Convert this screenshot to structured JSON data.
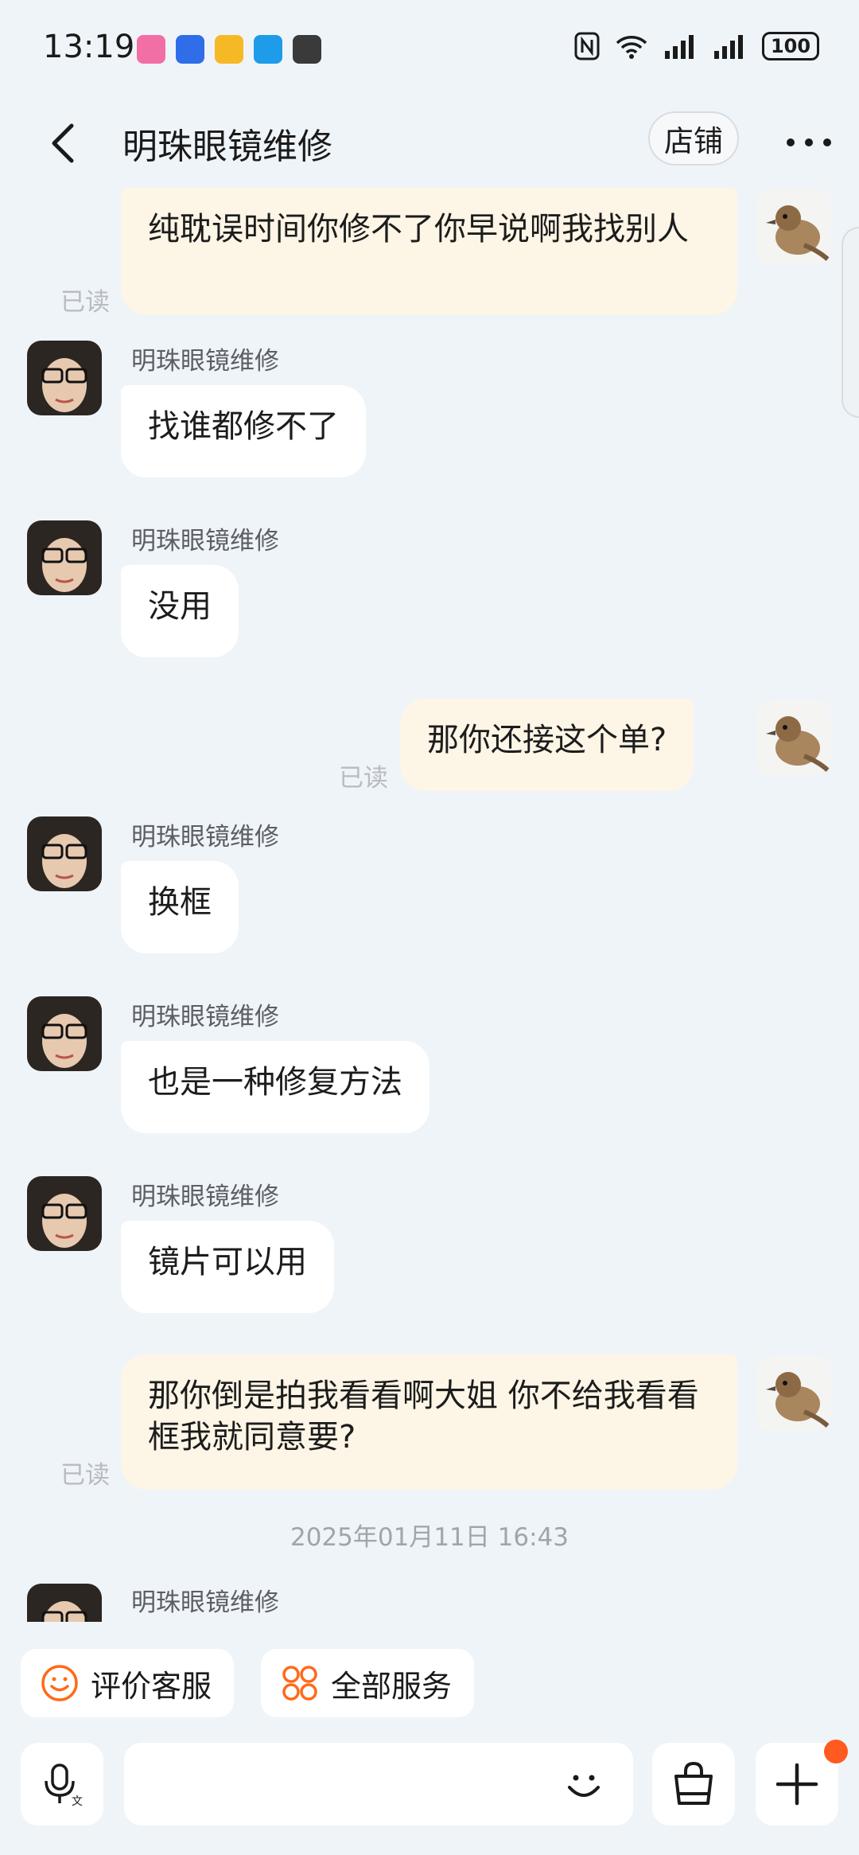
{
  "status_bar": {
    "time": "13:19",
    "battery": "100",
    "app_icons": [
      "bilibili-icon",
      "voice-recorder-icon",
      "mail-icon",
      "message-icon",
      "calligraphy-app-icon"
    ],
    "right_icons": [
      "nfc-icon",
      "wifi-icon",
      "signal-icon",
      "signal-icon"
    ]
  },
  "nav": {
    "title": "明珠眼镜维修",
    "store_label": "店铺"
  },
  "messages": [
    {
      "side": "out",
      "text": "纯耽误时间你修不了你早说啊我找别人",
      "read": "已读"
    },
    {
      "side": "in",
      "sender": "明珠眼镜维修",
      "text": "找谁都修不了"
    },
    {
      "side": "in",
      "sender": "明珠眼镜维修",
      "text": "没用"
    },
    {
      "side": "out",
      "text": "那你还接这个单?",
      "read": "已读"
    },
    {
      "side": "in",
      "sender": "明珠眼镜维修",
      "text": "换框"
    },
    {
      "side": "in",
      "sender": "明珠眼镜维修",
      "text": "也是一种修复方法"
    },
    {
      "side": "in",
      "sender": "明珠眼镜维修",
      "text": "镜片可以用"
    },
    {
      "side": "out",
      "text": "那你倒是拍我看看啊大姐 你不给我看看框我就同意要?",
      "read": "已读"
    },
    {
      "side": "in",
      "sender": "明珠眼镜维修",
      "text": ""
    }
  ],
  "timestamp": "2025年01月11日 16:43",
  "quick_actions": [
    {
      "label": "评价客服",
      "icon": "smile-icon"
    },
    {
      "label": "全部服务",
      "icon": "grid-icon"
    }
  ],
  "input": {
    "voice_icon": "voice-input-icon",
    "emoji_icon": "emoji-icon",
    "shop_icon": "shopping-bag-icon",
    "add_icon": "plus-icon"
  },
  "colors": {
    "background": "#eff4f8",
    "bubble_out": "#fdf5e6",
    "bubble_in": "#ffffff",
    "accent": "#ff6a1a"
  }
}
